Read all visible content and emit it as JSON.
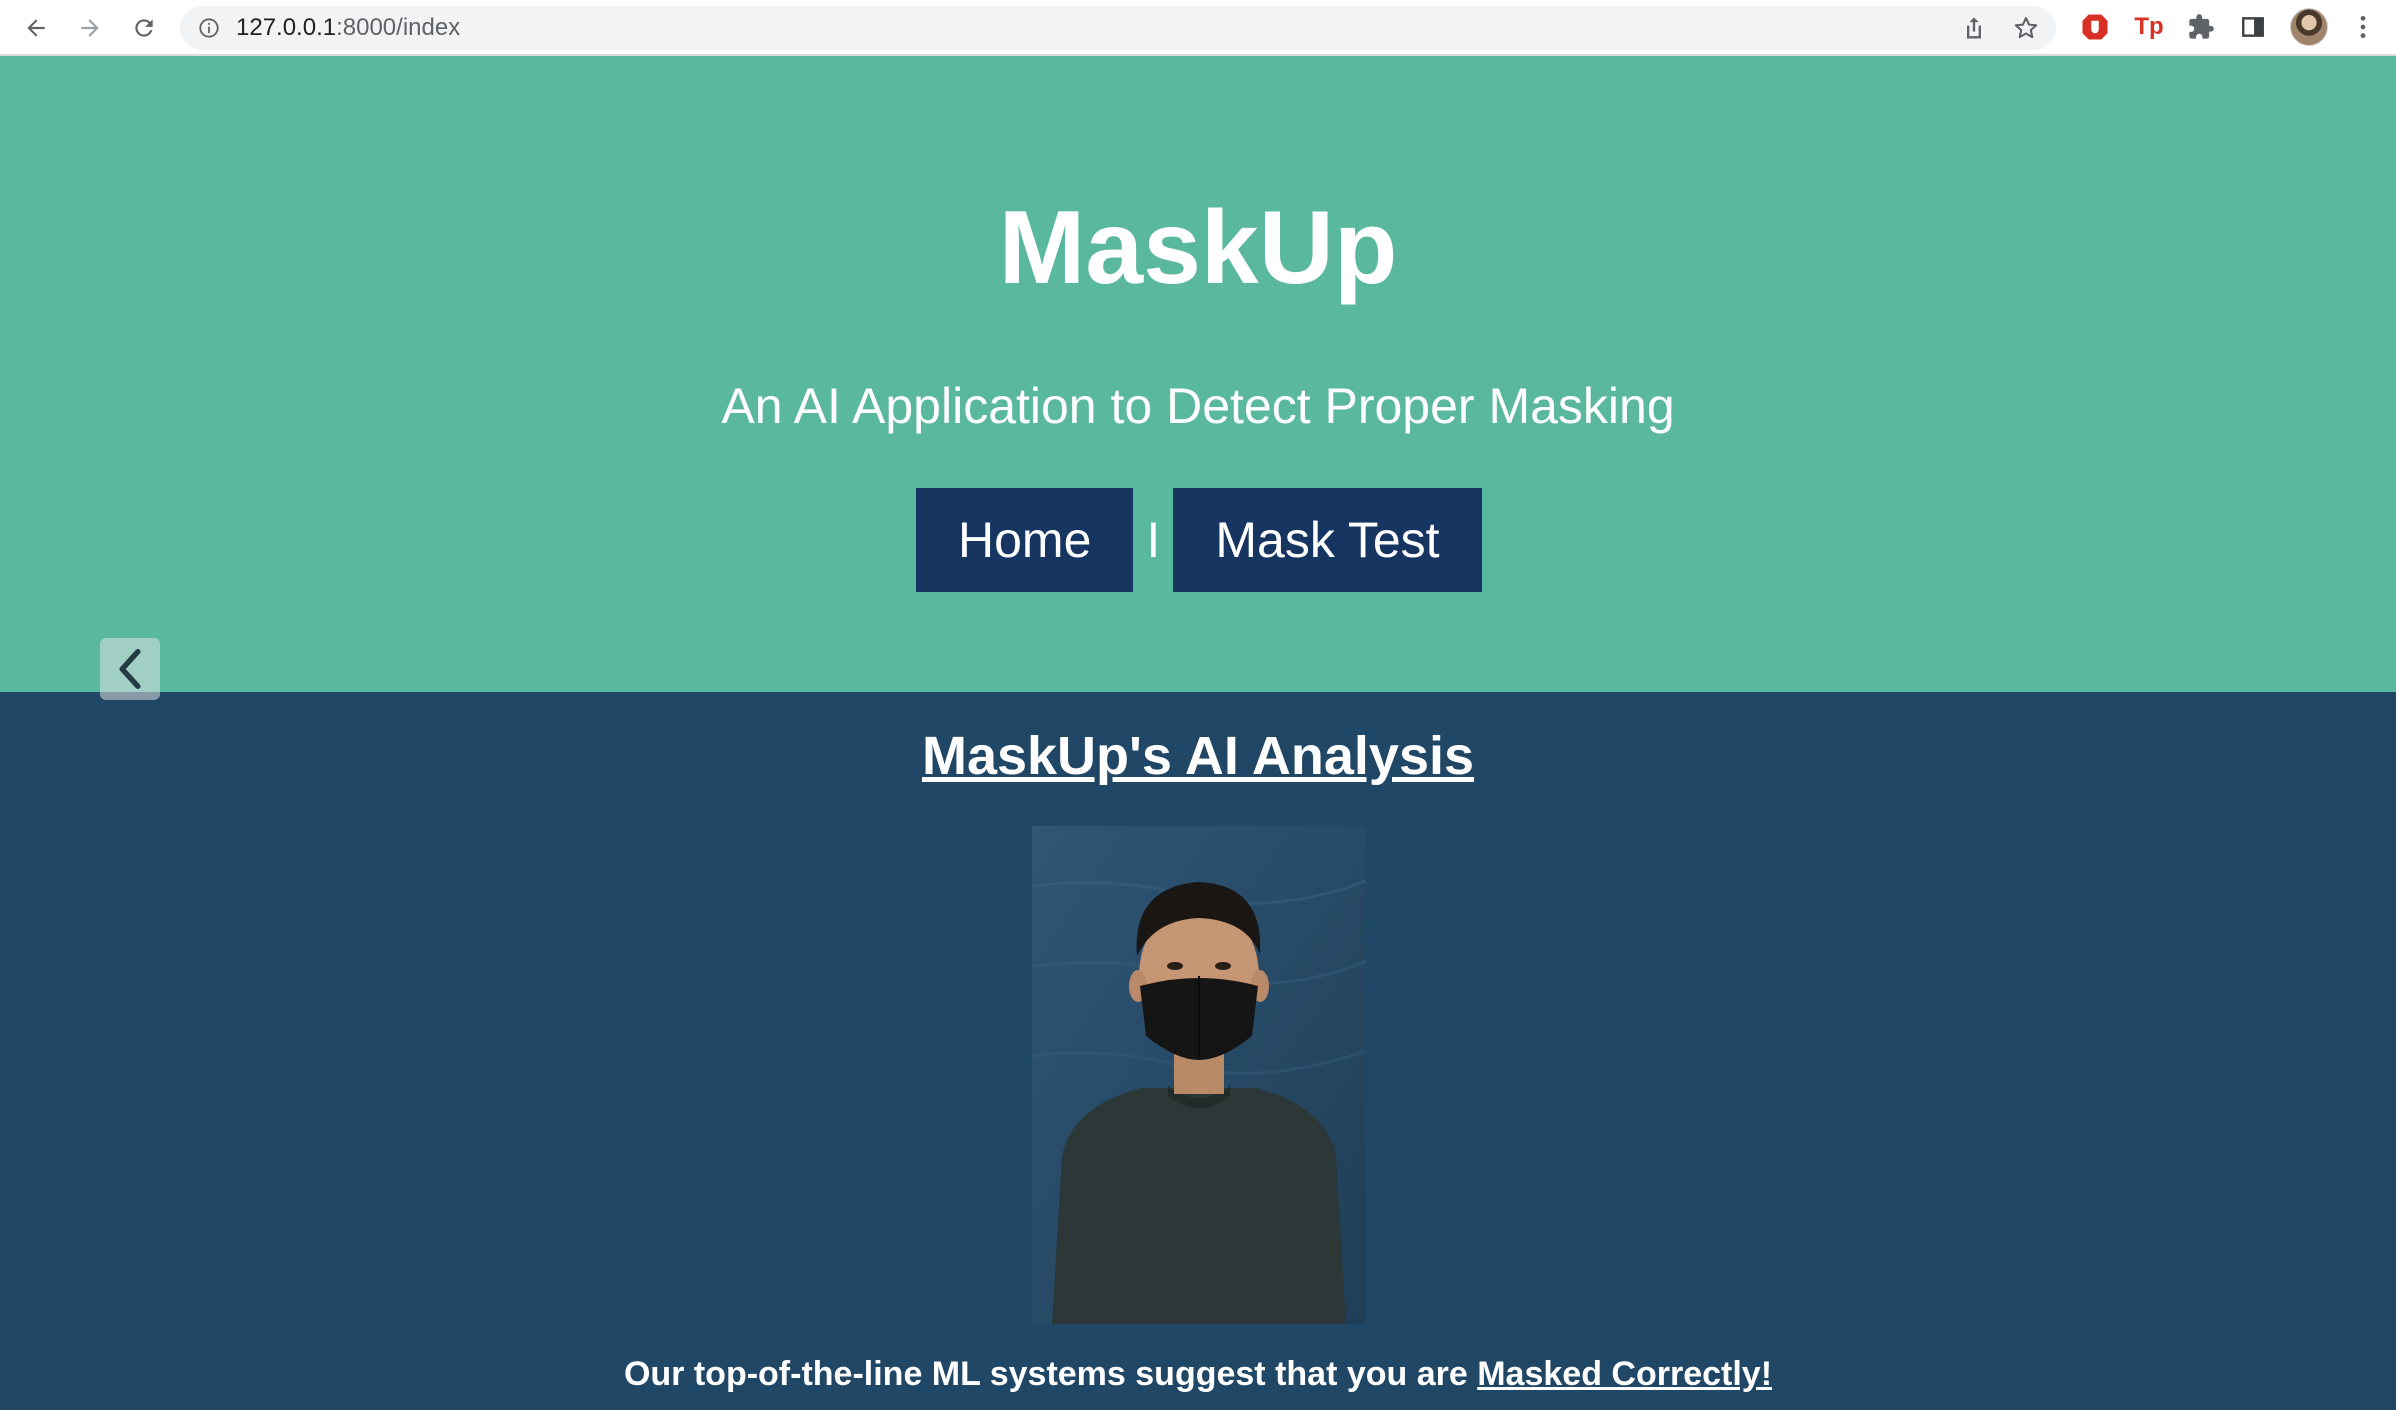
{
  "browser": {
    "url_host": "127.0.0.1",
    "url_path": ":8000/index",
    "icons": {
      "back": "arrow-left-icon",
      "forward": "arrow-right-icon",
      "reload": "reload-icon",
      "site_info": "info-icon",
      "share": "share-icon",
      "bookmark": "star-icon",
      "extensions": [
        "shield-extension-icon",
        "tp-extension-icon",
        "puzzle-icon",
        "side-panel-icon"
      ],
      "profile": "avatar",
      "menu": "kebab-menu-icon"
    },
    "extension_tp_label": "Tp"
  },
  "hero": {
    "title": "MaskUp",
    "subtitle": "An AI Application to Detect Proper Masking",
    "nav": {
      "home_label": "Home",
      "separator": "I",
      "mask_test_label": "Mask Test"
    }
  },
  "analysis": {
    "title": "MaskUp's AI Analysis",
    "result_prefix": "Our top-of-the-line ML systems suggest that you are ",
    "result_verdict": "Masked Correctly!"
  },
  "colors": {
    "hero_bg": "#59b89d",
    "analysis_bg": "#214766",
    "nav_button_bg": "#163560",
    "text": "#ffffff"
  }
}
